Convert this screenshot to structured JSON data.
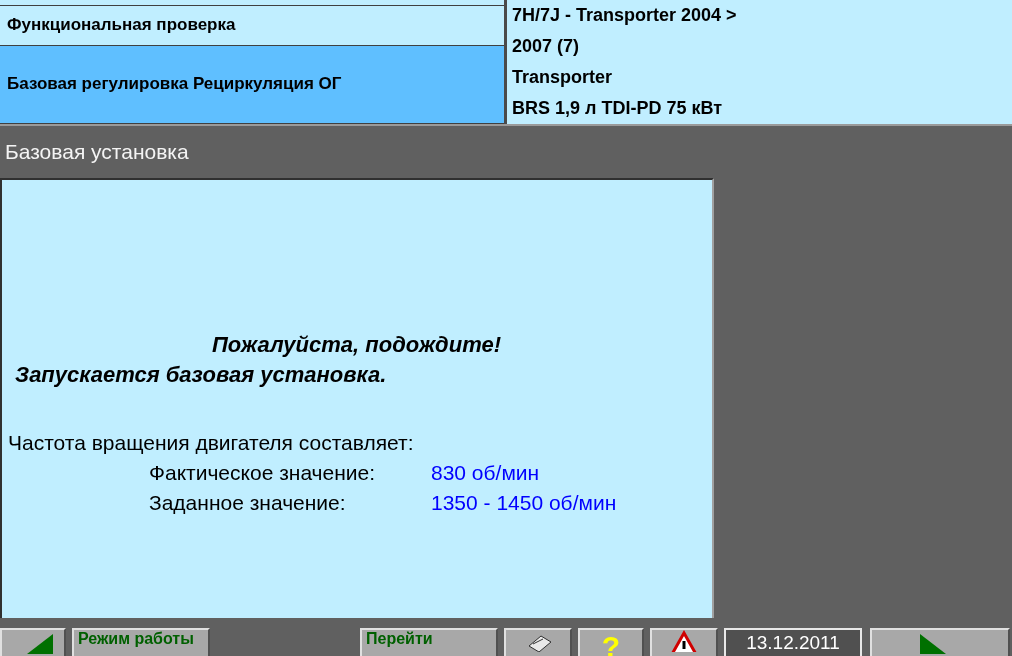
{
  "navigation": {
    "items": [
      {
        "label": "Функциональная проверка",
        "selected": false
      },
      {
        "label": "Базовая регулировка Рециркуляция ОГ",
        "selected": true
      }
    ]
  },
  "vehicle_info": {
    "lines": [
      "7H/7J - Transporter 2004 >",
      "2007 (7)",
      "Transporter",
      "BRS 1,9 л TDI-PD 75 кВт"
    ]
  },
  "section_title": "Базовая установка",
  "message": {
    "lines": [
      "Пожалуйста, подождите!",
      "Запускается базовая установка."
    ]
  },
  "readings": {
    "heading": "Частота вращения двигателя составляет:",
    "rows": [
      {
        "label": "Фактическое значение:",
        "value": "830 об/мин"
      },
      {
        "label": "Заданное значение:",
        "value": "1350 - 1450 об/мин"
      }
    ]
  },
  "bottom_bar": {
    "mode_button": "Режим работы",
    "goto_button": "Перейти",
    "help_button": "?",
    "date": "13.12.2011"
  }
}
